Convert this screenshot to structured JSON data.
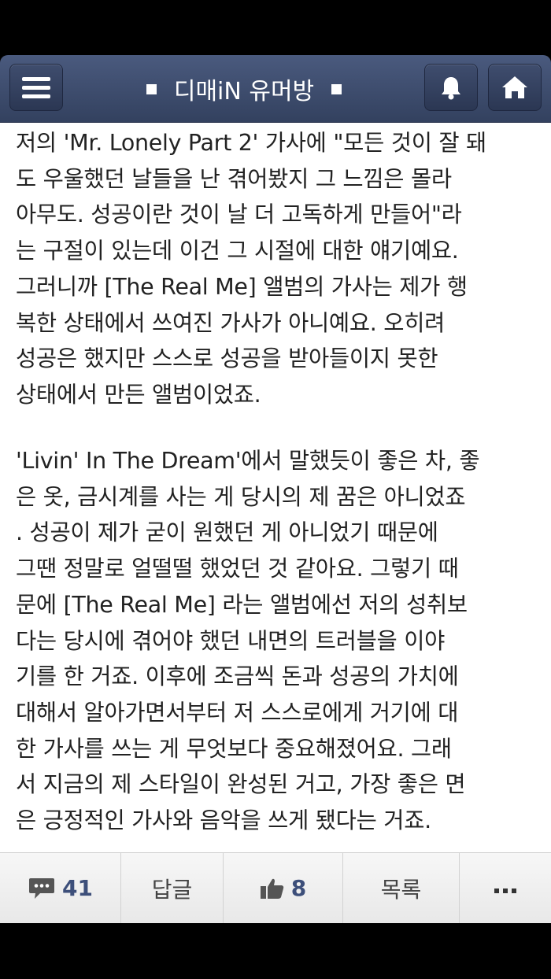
{
  "header": {
    "title": "디매iN 유머방",
    "menu_icon": "hamburger-menu-icon",
    "bell_icon": "bell-icon",
    "home_icon": "home-icon"
  },
  "article": {
    "paragraph_1": "저의 'Mr. Lonely Part 2' 가사에 \"모든 것이 잘 돼\n도 우울했던 날들을 난 겪어봤지 그 느낌은 몰라\n아무도. 성공이란 것이 날 더 고독하게 만들어\"라\n는 구절이 있는데 이건 그 시절에 대한 얘기예요.\n그러니까 [The Real Me] 앨범의 가사는 제가 행\n복한 상태에서 쓰여진 가사가 아니예요. 오히려\n성공은 했지만 스스로 성공을 받아들이지 못한\n상태에서 만든 앨범이었죠.",
    "paragraph_2": "'Livin' In The Dream'에서 말했듯이 좋은 차, 좋\n은 옷, 금시계를 사는 게 당시의 제 꿈은 아니었죠\n. 성공이 제가 굳이 원했던 게 아니었기 때문에\n그땐 정말로 얼떨떨 했었던 것 같아요. 그렇기 때\n문에 [The Real Me] 라는 앨범에선 저의 성취보\n다는 당시에 겪어야 했던 내면의 트러블을 이야\n기를 한 거죠. 이후에 조금씩 돈과 성공의 가치에\n대해서 알아가면서부터 저 스스로에게 거기에 대\n한 가사를 쓰는 게 무엇보다 중요해졌어요. 그래\n서 지금의 제 스타일이 완성된 거고, 가장 좋은 면\n은 긍정적인 가사와 음악을 쓰게 됐다는 거죠."
  },
  "bottom_bar": {
    "comment_count": "41",
    "reply_label": "답글",
    "like_count": "8",
    "list_label": "목록",
    "comment_icon": "speech-bubble-icon",
    "like_icon": "thumbs-up-icon",
    "more_icon": "more-dots-icon"
  },
  "colors": {
    "header_bg": "#3b4a6b",
    "count_text": "#3d4f7a"
  }
}
